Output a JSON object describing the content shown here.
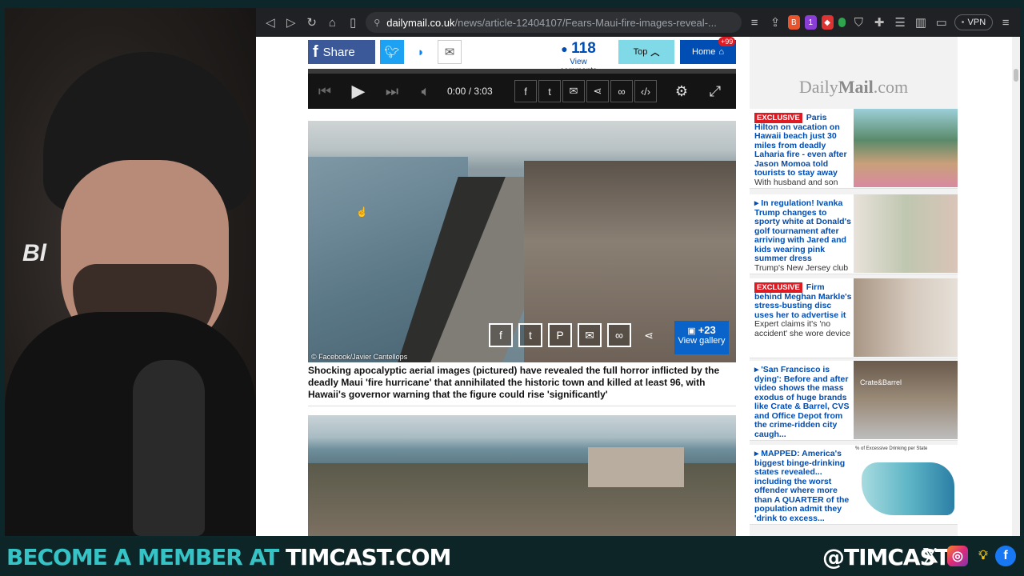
{
  "browser": {
    "url_domain": "dailymail.co.uk",
    "url_path": "/news/article-12404107/Fears-Maui-fire-images-reveal-...",
    "vpn_label": "VPN",
    "ext_badge": "1"
  },
  "share_bar": {
    "share_label": "Share",
    "comment_count": "118",
    "comment_label": "View comments",
    "top_label": "Top",
    "home_label": "Home",
    "home_badge": "+99"
  },
  "video": {
    "time": "0:00 / 3:03"
  },
  "main_image": {
    "credit": "© Facebook/Javier Cantellops",
    "gallery_count": "+23",
    "gallery_label": "View gallery"
  },
  "caption": "Shocking apocalyptic aerial images (pictured) have revealed the full horror inflicted by the deadly Maui 'fire hurricane' that annihilated the historic town and killed at least 96, with Hawaii's governor warning that the figure could rise 'significantly'",
  "sidebar": {
    "logo_a": "Daily",
    "logo_b": "Mail",
    "logo_c": ".com",
    "cards": [
      {
        "tag": "EXCLUSIVE",
        "title": "Paris Hilton on vacation on Hawaii beach just 30 miles from deadly Laharia fire - even after Jason Momoa told tourists to stay away",
        "sub": "With husband and son"
      },
      {
        "tag": "",
        "title": "In regulation! Ivanka Trump changes to sporty white at Donald's golf tournament after arriving with Jared and kids wearing pink summer dress",
        "sub": "Trump's New Jersey club"
      },
      {
        "tag": "EXCLUSIVE",
        "title": "Firm behind Meghan Markle's stress-busting disc uses her to advertise it",
        "sub": "Expert claims it's 'no accident' she wore device"
      },
      {
        "tag": "",
        "title": "'San Francisco is dying': Before and after video shows the mass exodus of huge brands like Crate & Barrel, CVS and Office Depot from the crime-ridden city caugh...",
        "sub": ""
      },
      {
        "tag": "",
        "title": "MAPPED: America's biggest binge-drinking states revealed... including the worst offender where more than A QUARTER of the population admit they 'drink to excess...",
        "sub": ""
      }
    ],
    "map_title": "% of Excessive Drinking per State",
    "store_sign": "Crate&Barrel"
  },
  "overlay": {
    "become": "BECOME A MEMBER AT",
    "site": "TIMCAST.COM",
    "handle": "@TIMCAST",
    "cam_brand": "Bl"
  },
  "colors": {
    "accent": "#36c3c6",
    "dm_blue": "#004db3",
    "exclusive_red": "#e01a22"
  }
}
